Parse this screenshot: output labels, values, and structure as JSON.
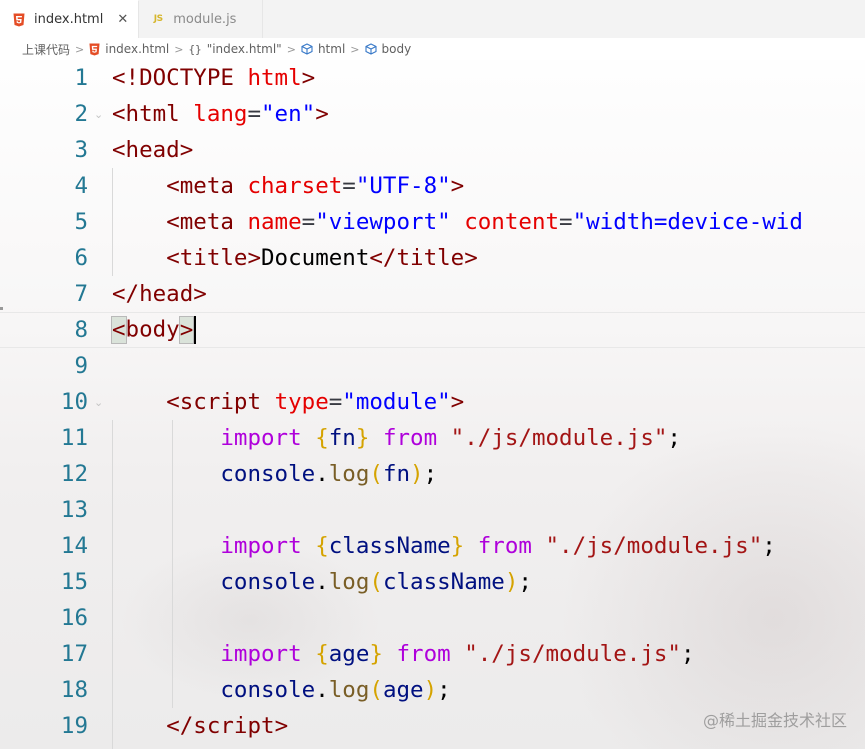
{
  "tabs": [
    {
      "label": "index.html",
      "type": "html",
      "active": true,
      "close": "✕"
    },
    {
      "label": "module.js",
      "type": "js",
      "active": false,
      "js_badge": "JS"
    }
  ],
  "breadcrumb": {
    "items": [
      "上课代码",
      "index.html",
      "\"index.html\"",
      "html",
      "body"
    ],
    "curly_symbol": "{}",
    "separator": ">"
  },
  "colors": {
    "tag": "#800000",
    "attribute": "#e50000",
    "string": "#0000ff",
    "keyword": "#af00db",
    "identifier": "#001080",
    "function": "#795e26",
    "js_string": "#a31515",
    "line_number": "#237893"
  },
  "code_lines": [
    {
      "n": "1",
      "fold": false
    },
    {
      "n": "2",
      "fold": true
    },
    {
      "n": "3",
      "fold": false
    },
    {
      "n": "4",
      "fold": false
    },
    {
      "n": "5",
      "fold": false
    },
    {
      "n": "6",
      "fold": false
    },
    {
      "n": "7",
      "fold": false
    },
    {
      "n": "8",
      "fold": false
    },
    {
      "n": "9",
      "fold": false
    },
    {
      "n": "10",
      "fold": true
    },
    {
      "n": "11",
      "fold": false
    },
    {
      "n": "12",
      "fold": false
    },
    {
      "n": "13",
      "fold": false
    },
    {
      "n": "14",
      "fold": false
    },
    {
      "n": "15",
      "fold": false
    },
    {
      "n": "16",
      "fold": false
    },
    {
      "n": "17",
      "fold": false
    },
    {
      "n": "18",
      "fold": false
    },
    {
      "n": "19",
      "fold": false
    }
  ],
  "tokens": {
    "l1": {
      "open": "<!",
      "doctype": "DOCTYPE",
      "html": "html",
      "close": ">"
    },
    "l2": {
      "open": "<",
      "tag": "html",
      "attr": "lang",
      "eq": "=",
      "val": "\"en\"",
      "close": ">"
    },
    "l3": {
      "open": "<",
      "tag": "head",
      "close": ">"
    },
    "l4": {
      "open": "<",
      "tag": "meta",
      "attr": "charset",
      "eq": "=",
      "val": "\"UTF-8\"",
      "close": ">"
    },
    "l5": {
      "open": "<",
      "tag": "meta",
      "attr1": "name",
      "eq1": "=",
      "val1": "\"viewport\"",
      "attr2": "content",
      "eq2": "=",
      "val2": "\"width=device-wid"
    },
    "l6": {
      "open": "<",
      "tag": "title",
      "close": ">",
      "text": "Document",
      "open2": "</",
      "tag2": "title",
      "close2": ">"
    },
    "l7": {
      "open": "</",
      "tag": "head",
      "close": ">"
    },
    "l8": {
      "open": "<",
      "tag": "body",
      "close": ">"
    },
    "l10": {
      "open": "<",
      "tag": "script",
      "attr": "type",
      "eq": "=",
      "val": "\"module\"",
      "close": ">"
    },
    "l11": {
      "kw": "import",
      "lb": "{",
      "id": "fn",
      "rb": "}",
      "from": "from",
      "str": "\"./js/module.js\"",
      "semi": ";"
    },
    "l12": {
      "obj": "console",
      "dot": ".",
      "fn": "log",
      "lp": "(",
      "arg": "fn",
      "rp": ")",
      "semi": ";"
    },
    "l14": {
      "kw": "import",
      "lb": "{",
      "id": "className",
      "rb": "}",
      "from": "from",
      "str": "\"./js/module.js\"",
      "semi": ";"
    },
    "l15": {
      "obj": "console",
      "dot": ".",
      "fn": "log",
      "lp": "(",
      "arg": "className",
      "rp": ")",
      "semi": ";"
    },
    "l17": {
      "kw": "import",
      "lb": "{",
      "id": "age",
      "rb": "}",
      "from": "from",
      "str": "\"./js/module.js\"",
      "semi": ";"
    },
    "l18": {
      "obj": "console",
      "dot": ".",
      "fn": "log",
      "lp": "(",
      "arg": "age",
      "rp": ")",
      "semi": ";"
    },
    "l19": {
      "open": "</",
      "tag": "script",
      "close": ">"
    }
  },
  "watermark": "@稀土掘金技术社区"
}
